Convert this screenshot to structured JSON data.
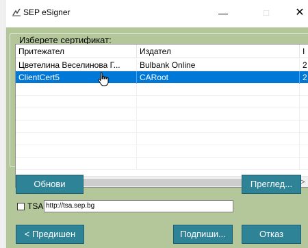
{
  "window": {
    "title": "SEP eSigner",
    "minimize_glyph": "—",
    "maximize_glyph": "□",
    "close_glyph": "✕"
  },
  "certificates": {
    "group_label": "Изберете сертификат:",
    "columns": [
      "Притежател",
      "Издател",
      "I"
    ],
    "rows": [
      {
        "holder": "Цветелина Веселинова Г...",
        "issuer": "Bulbank Online",
        "extra": "2",
        "selected": false
      },
      {
        "holder": "ClientCert5",
        "issuer": "CARoot",
        "extra": "2",
        "selected": true
      }
    ],
    "scroll_left": "<",
    "scroll_right": ">"
  },
  "buttons": {
    "refresh": "Обнови",
    "preview": "Преглед...",
    "previous": "< Предишен",
    "sign": "Подпиши...",
    "cancel": "Отказ"
  },
  "tsa": {
    "label": "TSA:",
    "checked": false,
    "value": "http://tsa.sep.bg"
  },
  "colors": {
    "background": "#b3c79a",
    "button": "#2f8396",
    "selection": "#0078d7"
  },
  "icons": {
    "app": "sep-logo-icon",
    "cursor": "hand-pointer-icon"
  }
}
